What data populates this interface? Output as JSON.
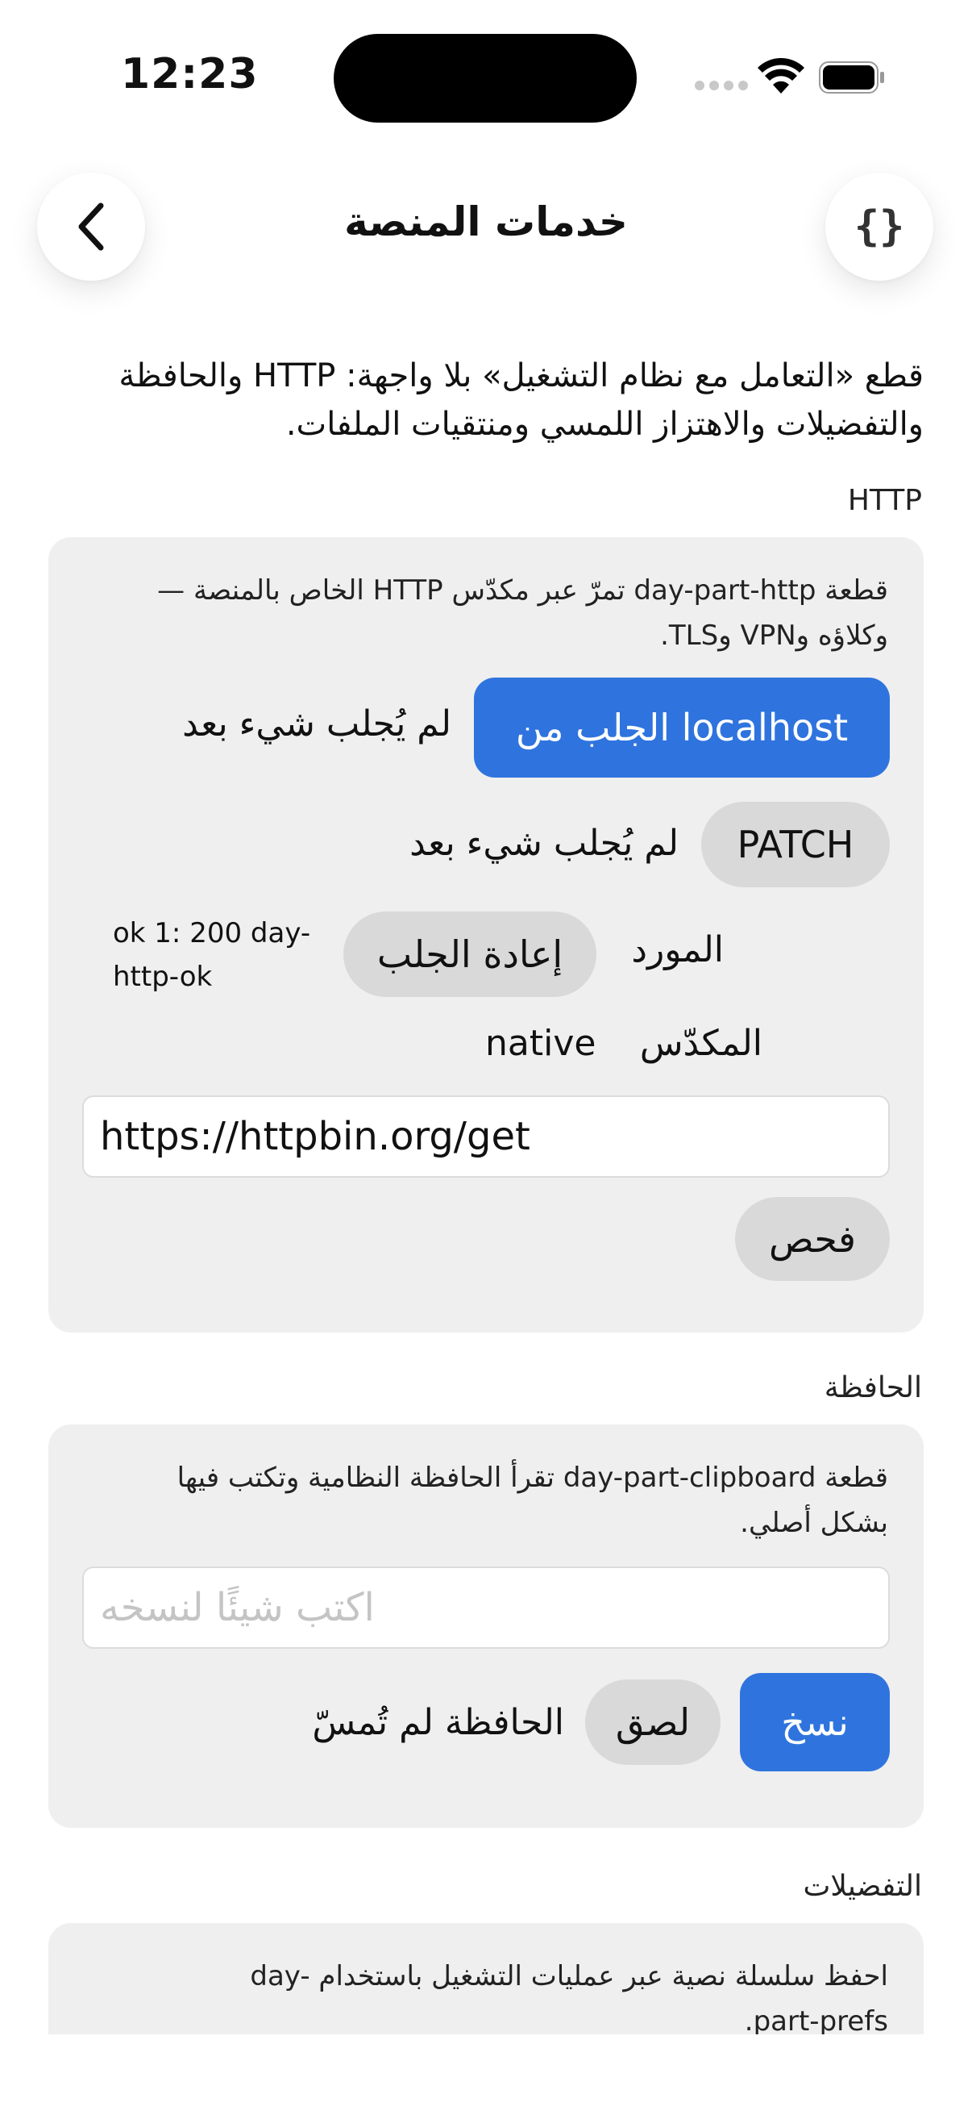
{
  "status": {
    "time": "12:23"
  },
  "nav": {
    "title": "خدمات المنصة",
    "code_glyph": "{}"
  },
  "intro": "قطع «التعامل مع نظام التشغيل» بلا واجهة: HTTP والحافظة والتفضيلات والاهتزاز اللمسي ومنتقيات الملفات.",
  "http": {
    "section": "HTTP",
    "description": "قطعة day-part-http تمرّ عبر مكدّس HTTP الخاص بالمنصة — وكلاؤه وVPN وTLS.",
    "fetch_local_label": "الجلب من localhost",
    "fetch_local_status": "لم يُجلب شيء بعد",
    "patch_label": "PATCH",
    "patch_status": "لم يُجلب شيء بعد",
    "resource_label": "المورد",
    "refetch_label": "إعادة الجلب",
    "resource_value": "ok 1: 200 day-http-ok",
    "stack_label": "المكدّس",
    "stack_value": "native",
    "url_value": "https://httpbin.org/get",
    "check_label": "فحص"
  },
  "clipboard": {
    "section": "الحافظة",
    "description": "قطعة day-part-clipboard تقرأ الحافظة النظامية وتكتب فيها بشكل أصلي.",
    "input_placeholder": "اكتب شيئًا لنسخه",
    "copy_label": "نسخ",
    "paste_label": "لصق",
    "status": "الحافظة لم تُمسّ"
  },
  "prefs": {
    "section": "التفضيلات",
    "description": "احفظ سلسلة نصية عبر عمليات التشغيل باستخدام day-part-prefs."
  }
}
